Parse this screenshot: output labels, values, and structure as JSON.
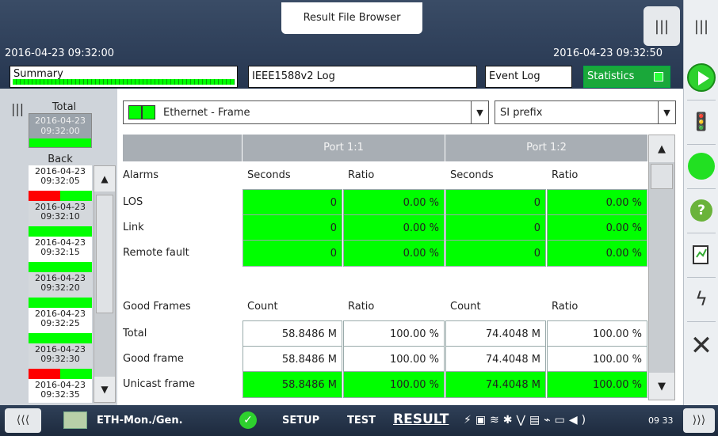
{
  "window": {
    "title": "Result File Browser"
  },
  "header": {
    "start_time": "2016-04-23 09:32:00",
    "end_time": "2016-04-23 09:32:50",
    "tabs": [
      {
        "label": "Summary"
      },
      {
        "label": "IEEE1588v2 Log"
      },
      {
        "label": "Event Log"
      },
      {
        "label": "Statistics"
      }
    ]
  },
  "history": {
    "total_label": "Total",
    "total_time": "2016-04-23 09:32:00",
    "back_label": "Back",
    "items": [
      {
        "date": "2016-04-23",
        "time": "09:32:05",
        "status": [
          "red",
          "green"
        ]
      },
      {
        "date": "2016-04-23",
        "time": "09:32:10",
        "status": [
          "green"
        ]
      },
      {
        "date": "2016-04-23",
        "time": "09:32:15",
        "status": [
          "green"
        ]
      },
      {
        "date": "2016-04-23",
        "time": "09:32:20",
        "status": [
          "green"
        ]
      },
      {
        "date": "2016-04-23",
        "time": "09:32:25",
        "status": [
          "green"
        ]
      },
      {
        "date": "2016-04-23",
        "time": "09:32:30",
        "status": [
          "red",
          "green"
        ]
      },
      {
        "date": "2016-04-23",
        "time": "09:32:35",
        "status": []
      }
    ]
  },
  "filters": {
    "layer": "Ethernet - Frame",
    "unit": "SI prefix"
  },
  "ports": [
    "Port 1:1",
    "Port 1:2"
  ],
  "sections": {
    "alarms": {
      "title": "Alarms",
      "col_a": "Seconds",
      "col_b": "Ratio",
      "rows": [
        {
          "label": "LOS",
          "p1": [
            "0",
            "0.00 %"
          ],
          "p2": [
            "0",
            "0.00 %"
          ]
        },
        {
          "label": "Link",
          "p1": [
            "0",
            "0.00 %"
          ],
          "p2": [
            "0",
            "0.00 %"
          ]
        },
        {
          "label": "Remote fault",
          "p1": [
            "0",
            "0.00 %"
          ],
          "p2": [
            "0",
            "0.00 %"
          ]
        }
      ]
    },
    "good_frames": {
      "title": "Good Frames",
      "col_a": "Count",
      "col_b": "Ratio",
      "rows": [
        {
          "label": "Total",
          "p1": [
            "58.8486 M",
            "100.00 %"
          ],
          "p2": [
            "74.4048 M",
            "100.00 %"
          ]
        },
        {
          "label": "Good frame",
          "p1": [
            "58.8486 M",
            "100.00 %"
          ],
          "p2": [
            "74.4048 M",
            "100.00 %"
          ]
        },
        {
          "label": "Unicast frame",
          "p1": [
            "58.8486 M",
            "100.00 %"
          ],
          "p2": [
            "74.4048 M",
            "100.00 %"
          ]
        }
      ]
    }
  },
  "bottom": {
    "module": "ETH-Mon./Gen.",
    "nav": [
      "SETUP",
      "TEST",
      "RESULT"
    ],
    "clock": "09 33"
  },
  "colors": {
    "ok": "#00ff00",
    "alarm": "#ff0000",
    "accent": "#1aa83a"
  }
}
